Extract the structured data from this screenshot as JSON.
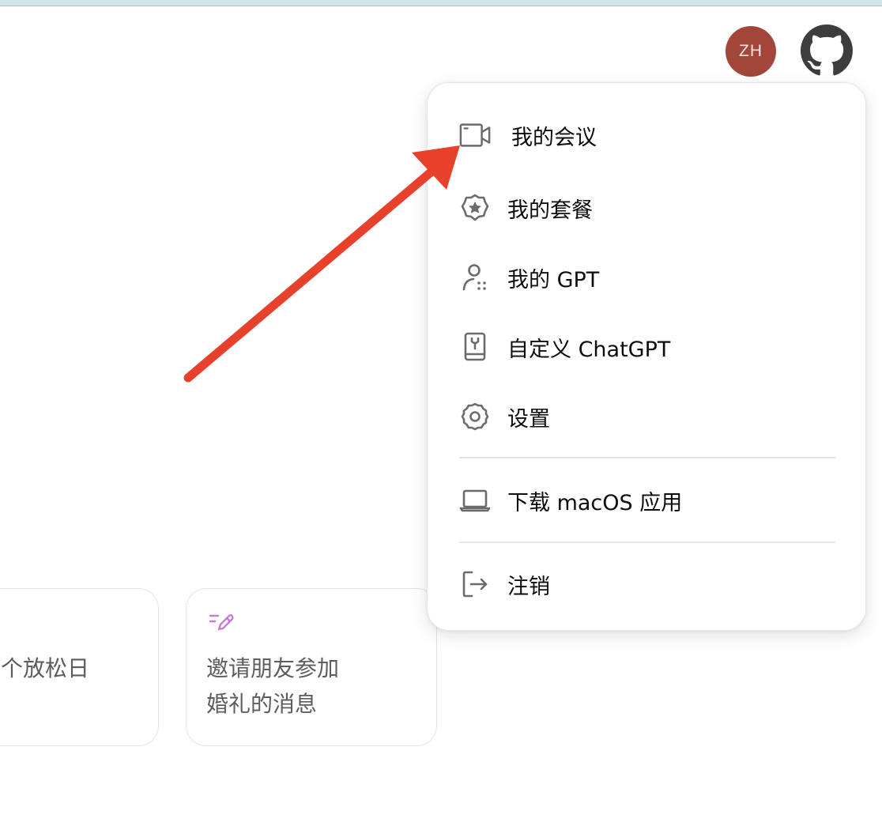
{
  "header": {
    "avatar_initials": "ZH",
    "avatar_color": "#a2463a",
    "github_icon": "github-icon"
  },
  "suggestions": [
    {
      "text": "个放松日",
      "icon": ""
    },
    {
      "text": "邀请朋友参加\n婚礼的消息",
      "icon": "pen-icon",
      "icon_color": "#c27fd1"
    }
  ],
  "menu": {
    "items": [
      {
        "label": "我的会议",
        "icon": "video-camera-icon"
      },
      {
        "label": "我的套餐",
        "icon": "star-badge-icon"
      },
      {
        "label": "我的 GPT",
        "icon": "user-grid-icon"
      },
      {
        "label": "自定义 ChatGPT",
        "icon": "book-tool-icon"
      },
      {
        "label": "设置",
        "icon": "gear-icon"
      },
      {
        "label": "下载 macOS 应用",
        "icon": "laptop-icon"
      },
      {
        "label": "注销",
        "icon": "logout-icon"
      }
    ]
  },
  "annotation": {
    "arrow_color": "#e8412b"
  }
}
